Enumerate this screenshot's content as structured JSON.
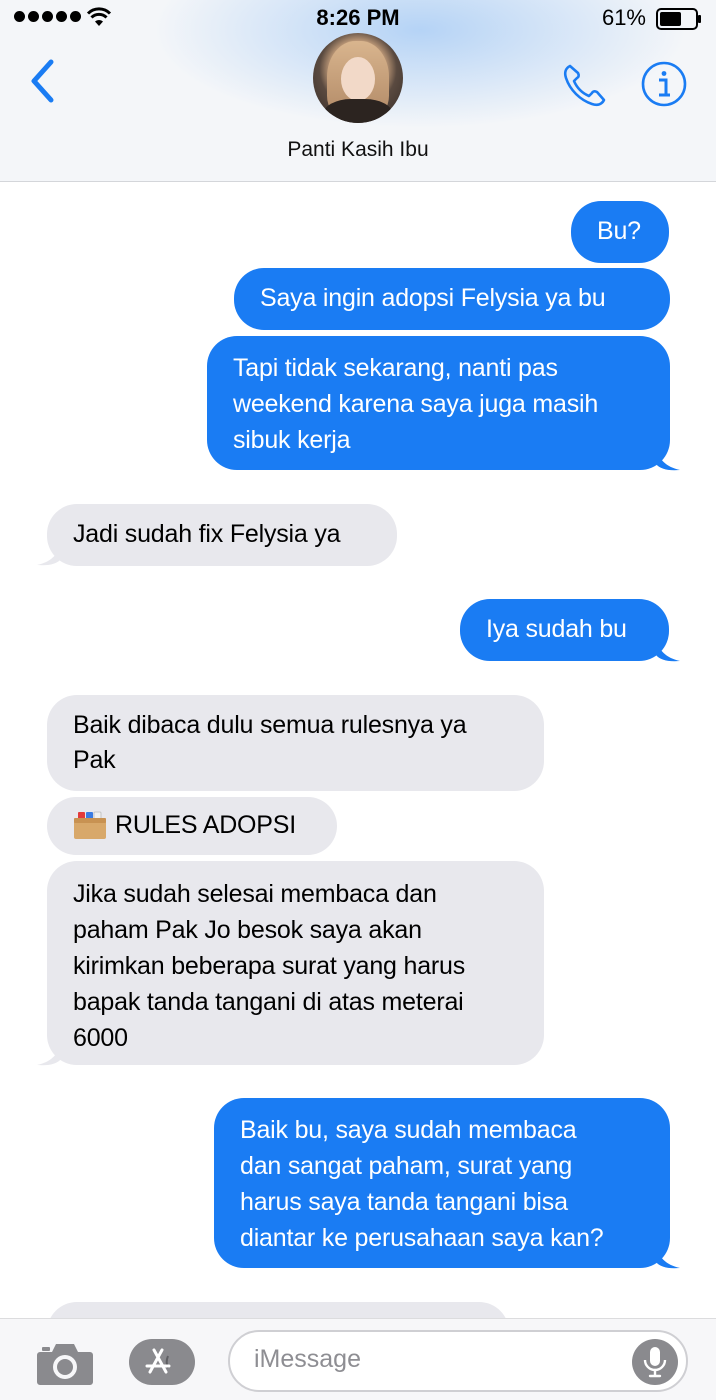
{
  "status_bar": {
    "time": "8:26 PM",
    "battery_percent": "61%",
    "signal_bars": 5,
    "battery_level": 0.61
  },
  "header": {
    "contact_name": "Panti Kasih Ibu",
    "back_icon": "chevron-left-icon",
    "call_icon": "phone-icon",
    "info_icon": "info-icon",
    "accent_color": "#1a7cf3"
  },
  "messages": [
    {
      "from": "me",
      "lines": [
        "Bu?"
      ]
    },
    {
      "from": "me",
      "lines": [
        "Saya ingin adopsi Felysia ya bu"
      ]
    },
    {
      "from": "me",
      "lines": [
        "Tapi tidak sekarang, nanti pas",
        "weekend karena saya juga masih",
        "sibuk kerja"
      ]
    },
    {
      "from": "them",
      "lines": [
        "Jadi sudah fix Felysia ya"
      ]
    },
    {
      "from": "me",
      "lines": [
        "Iya sudah bu"
      ]
    },
    {
      "from": "them",
      "lines": [
        "Baik dibaca dulu semua rulesnya ya",
        "Pak"
      ]
    },
    {
      "from": "them",
      "icon": "file-box-icon",
      "lines": [
        "RULES ADOPSI"
      ]
    },
    {
      "from": "them",
      "lines": [
        "Jika sudah selesai membaca dan",
        "paham Pak Jo besok saya akan",
        "kirimkan beberapa surat yang harus",
        "bapak tanda tangani di atas meterai",
        "6000"
      ]
    },
    {
      "from": "me",
      "lines": [
        "Baik bu, saya sudah membaca",
        "dan sangat paham, surat yang",
        "harus saya tanda tangani bisa",
        "diantar ke perusahaan saya kan?"
      ]
    }
  ],
  "input_bar": {
    "placeholder": "iMessage",
    "camera_icon": "camera-icon",
    "apps_icon": "app-store-icon",
    "mic_icon": "microphone-icon"
  },
  "colors": {
    "sent_bubble": "#1a7cf3",
    "received_bubble": "#e8e8ed"
  }
}
